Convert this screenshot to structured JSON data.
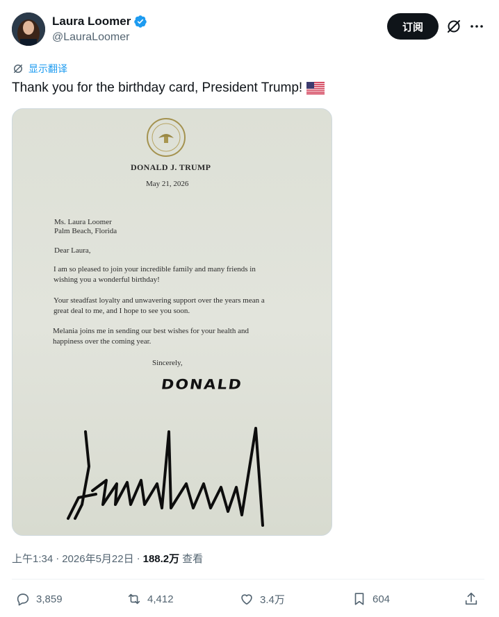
{
  "author": {
    "name": "Laura Loomer",
    "handle": "@LauraLoomer",
    "verified": true
  },
  "header": {
    "subscribe_label": "订阅"
  },
  "translate_label": "显示翻译",
  "tweet_text": "Thank you for the birthday card, President Trump!",
  "letter": {
    "sender": "DONALD J. TRUMP",
    "date": "May 21, 2026",
    "recipient_name": "Ms. Laura Loomer",
    "recipient_location": "Palm Beach, Florida",
    "salutation": "Dear Laura,",
    "paragraph1_line1": "I am so pleased to join your incredible family and many friends in",
    "paragraph1_line2": "wishing you a wonderful birthday!",
    "paragraph2_line1": "Your steadfast loyalty and unwavering support over the years mean a",
    "paragraph2_line2": "great deal to me, and I hope to see you soon.",
    "paragraph3_line1": "Melania joins me in sending our best wishes for your health and",
    "paragraph3_line2": "happiness over the coming year.",
    "closing": "Sincerely,",
    "signature_handwritten": "DONALD"
  },
  "meta": {
    "time": "上午1:34",
    "date": "2026年5月22日",
    "views_count": "188.2万",
    "views_label": "查看"
  },
  "actions": {
    "replies": "3,859",
    "reposts": "4,412",
    "likes": "3.4万",
    "bookmarks": "604"
  },
  "colors": {
    "accent": "#1d9bf0",
    "text_primary": "#0f1419",
    "text_secondary": "#536471"
  }
}
